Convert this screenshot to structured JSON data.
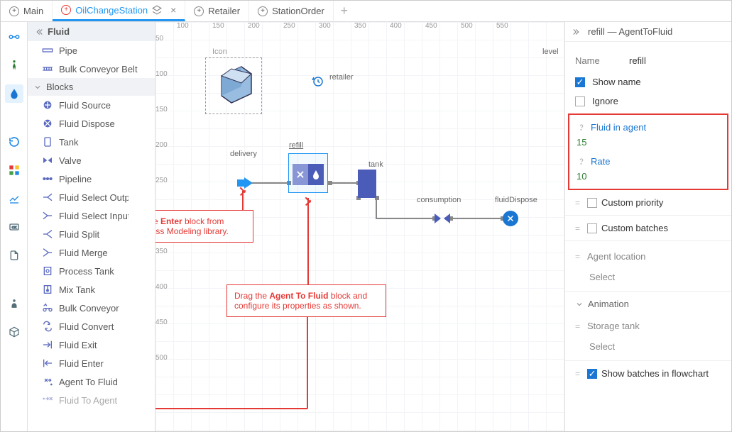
{
  "tabs": {
    "items": [
      {
        "label": "Main"
      },
      {
        "label": "OilChangeStation"
      },
      {
        "label": "Retailer"
      },
      {
        "label": "StationOrder"
      }
    ]
  },
  "palette": {
    "header": "Fluid",
    "groups": [
      {
        "label": "Pipe"
      },
      {
        "label": "Bulk Conveyor Belt"
      }
    ],
    "blocksHeader": "Blocks",
    "items": [
      {
        "label": "Fluid Source"
      },
      {
        "label": "Fluid Dispose"
      },
      {
        "label": "Tank"
      },
      {
        "label": "Valve"
      },
      {
        "label": "Pipeline"
      },
      {
        "label": "Fluid Select Output"
      },
      {
        "label": "Fluid Select Input"
      },
      {
        "label": "Fluid Split"
      },
      {
        "label": "Fluid Merge"
      },
      {
        "label": "Process Tank"
      },
      {
        "label": "Mix Tank"
      },
      {
        "label": "Bulk Conveyor"
      },
      {
        "label": "Fluid Convert"
      },
      {
        "label": "Fluid Exit"
      },
      {
        "label": "Fluid Enter"
      },
      {
        "label": "Agent To Fluid"
      },
      {
        "label": "Fluid To Agent"
      }
    ]
  },
  "canvas": {
    "rulerH": [
      "100",
      "150",
      "200",
      "250",
      "300",
      "350",
      "400",
      "450",
      "500",
      "550"
    ],
    "rulerV": [
      "50",
      "100",
      "150",
      "200",
      "250",
      "300",
      "350",
      "400",
      "450",
      "500"
    ],
    "iconLabel": "Icon",
    "levelLabel": "level",
    "retailerLabel": "retailer",
    "deliveryLabel": "delivery",
    "refillLabel": "refill",
    "tankLabel": "tank",
    "consumptionLabel": "consumption",
    "fluidDisposeLabel": "fluidDispose"
  },
  "callouts": {
    "enter1": "This is the ",
    "enterBold": "Enter",
    "enter2": " block from",
    "enter3": "the Process Modeling library.",
    "drag1": "Drag the ",
    "dragBold": "Agent To Fluid",
    "drag2": " block and",
    "drag3": "configure its properties as shown."
  },
  "props": {
    "header": "refill — AgentToFluid",
    "nameLabel": "Name",
    "nameValue": "refill",
    "showName": "Show name",
    "ignore": "Ignore",
    "fluidInAgent": "Fluid in agent",
    "fluidInAgentVal": "15",
    "rate": "Rate",
    "rateVal": "10",
    "customPriority": "Custom priority",
    "customBatches": "Custom batches",
    "agentLocation": "Agent location",
    "select": "Select",
    "animation": "Animation",
    "storageTank": "Storage tank",
    "showBatches": "Show batches in flowchart"
  }
}
